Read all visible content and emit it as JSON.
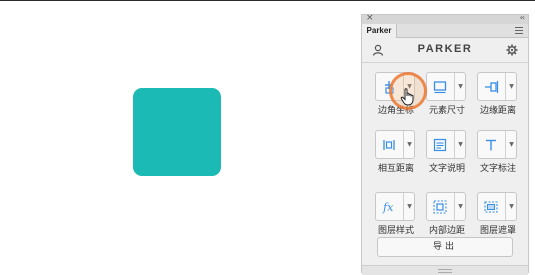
{
  "panel": {
    "tab_label": "Parker",
    "close_glyph": "×",
    "collapse_glyph": "‹‹",
    "brand": "PARKER",
    "export_label": "导出"
  },
  "tools": [
    {
      "label": "边角坐标",
      "icon": "corner-coordinate-icon"
    },
    {
      "label": "元素尺寸",
      "icon": "element-size-icon"
    },
    {
      "label": "边缘距离",
      "icon": "edge-distance-icon"
    },
    {
      "label": "相互距离",
      "icon": "mutual-distance-icon"
    },
    {
      "label": "文字说明",
      "icon": "text-description-icon"
    },
    {
      "label": "文字标注",
      "icon": "text-annotation-icon"
    },
    {
      "label": "图层样式",
      "icon": "layer-style-icon"
    },
    {
      "label": "内部边距",
      "icon": "inner-padding-icon"
    },
    {
      "label": "图层遮罩",
      "icon": "layer-mask-icon"
    }
  ],
  "colors": {
    "shape_fill": "#1cbab5",
    "accent_blue": "#3a8ee6",
    "click_ring": "#ea7832"
  }
}
